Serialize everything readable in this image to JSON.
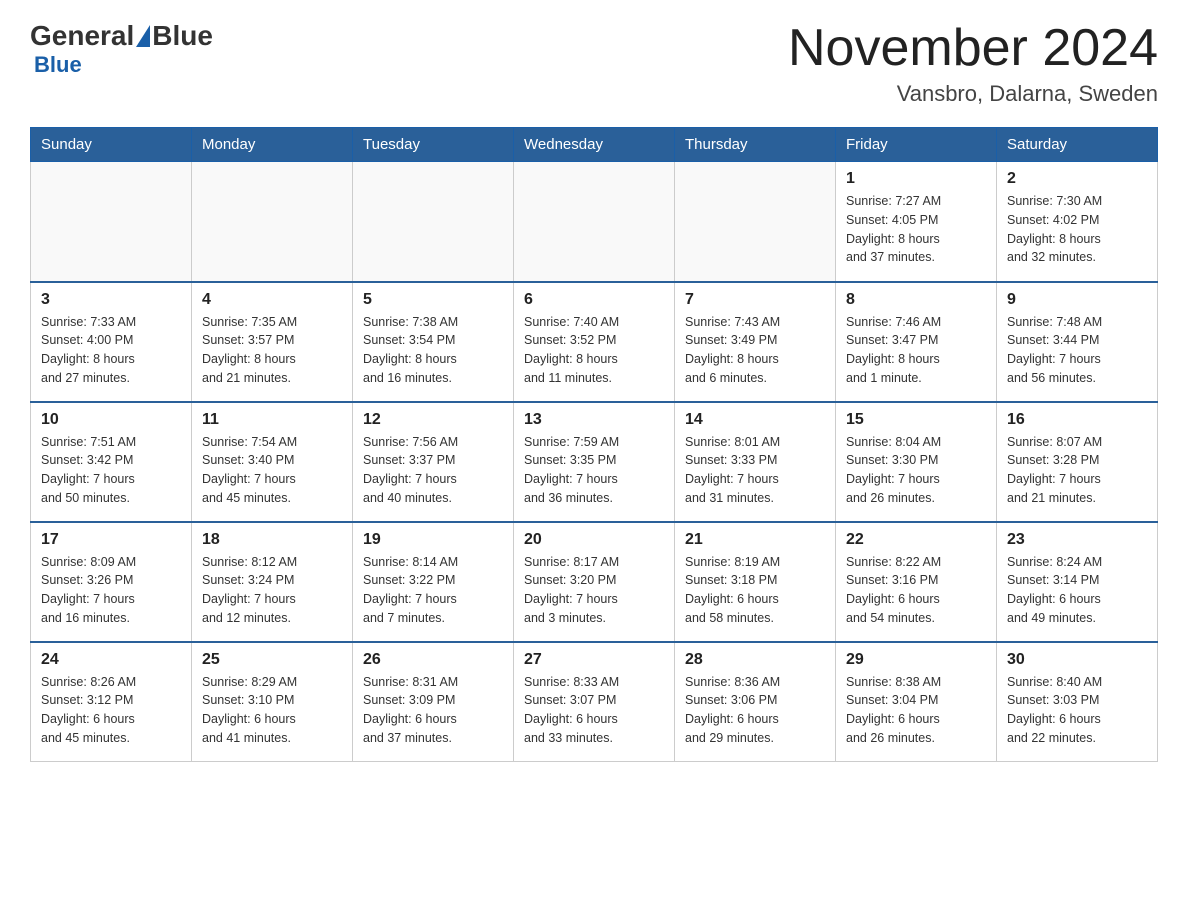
{
  "header": {
    "logo": {
      "part1": "General",
      "part2": "Blue",
      "subtitle": "Blue"
    },
    "title": "November 2024",
    "location": "Vansbro, Dalarna, Sweden"
  },
  "weekdays": [
    "Sunday",
    "Monday",
    "Tuesday",
    "Wednesday",
    "Thursday",
    "Friday",
    "Saturday"
  ],
  "weeks": [
    [
      {
        "day": "",
        "info": ""
      },
      {
        "day": "",
        "info": ""
      },
      {
        "day": "",
        "info": ""
      },
      {
        "day": "",
        "info": ""
      },
      {
        "day": "",
        "info": ""
      },
      {
        "day": "1",
        "info": "Sunrise: 7:27 AM\nSunset: 4:05 PM\nDaylight: 8 hours\nand 37 minutes."
      },
      {
        "day": "2",
        "info": "Sunrise: 7:30 AM\nSunset: 4:02 PM\nDaylight: 8 hours\nand 32 minutes."
      }
    ],
    [
      {
        "day": "3",
        "info": "Sunrise: 7:33 AM\nSunset: 4:00 PM\nDaylight: 8 hours\nand 27 minutes."
      },
      {
        "day": "4",
        "info": "Sunrise: 7:35 AM\nSunset: 3:57 PM\nDaylight: 8 hours\nand 21 minutes."
      },
      {
        "day": "5",
        "info": "Sunrise: 7:38 AM\nSunset: 3:54 PM\nDaylight: 8 hours\nand 16 minutes."
      },
      {
        "day": "6",
        "info": "Sunrise: 7:40 AM\nSunset: 3:52 PM\nDaylight: 8 hours\nand 11 minutes."
      },
      {
        "day": "7",
        "info": "Sunrise: 7:43 AM\nSunset: 3:49 PM\nDaylight: 8 hours\nand 6 minutes."
      },
      {
        "day": "8",
        "info": "Sunrise: 7:46 AM\nSunset: 3:47 PM\nDaylight: 8 hours\nand 1 minute."
      },
      {
        "day": "9",
        "info": "Sunrise: 7:48 AM\nSunset: 3:44 PM\nDaylight: 7 hours\nand 56 minutes."
      }
    ],
    [
      {
        "day": "10",
        "info": "Sunrise: 7:51 AM\nSunset: 3:42 PM\nDaylight: 7 hours\nand 50 minutes."
      },
      {
        "day": "11",
        "info": "Sunrise: 7:54 AM\nSunset: 3:40 PM\nDaylight: 7 hours\nand 45 minutes."
      },
      {
        "day": "12",
        "info": "Sunrise: 7:56 AM\nSunset: 3:37 PM\nDaylight: 7 hours\nand 40 minutes."
      },
      {
        "day": "13",
        "info": "Sunrise: 7:59 AM\nSunset: 3:35 PM\nDaylight: 7 hours\nand 36 minutes."
      },
      {
        "day": "14",
        "info": "Sunrise: 8:01 AM\nSunset: 3:33 PM\nDaylight: 7 hours\nand 31 minutes."
      },
      {
        "day": "15",
        "info": "Sunrise: 8:04 AM\nSunset: 3:30 PM\nDaylight: 7 hours\nand 26 minutes."
      },
      {
        "day": "16",
        "info": "Sunrise: 8:07 AM\nSunset: 3:28 PM\nDaylight: 7 hours\nand 21 minutes."
      }
    ],
    [
      {
        "day": "17",
        "info": "Sunrise: 8:09 AM\nSunset: 3:26 PM\nDaylight: 7 hours\nand 16 minutes."
      },
      {
        "day": "18",
        "info": "Sunrise: 8:12 AM\nSunset: 3:24 PM\nDaylight: 7 hours\nand 12 minutes."
      },
      {
        "day": "19",
        "info": "Sunrise: 8:14 AM\nSunset: 3:22 PM\nDaylight: 7 hours\nand 7 minutes."
      },
      {
        "day": "20",
        "info": "Sunrise: 8:17 AM\nSunset: 3:20 PM\nDaylight: 7 hours\nand 3 minutes."
      },
      {
        "day": "21",
        "info": "Sunrise: 8:19 AM\nSunset: 3:18 PM\nDaylight: 6 hours\nand 58 minutes."
      },
      {
        "day": "22",
        "info": "Sunrise: 8:22 AM\nSunset: 3:16 PM\nDaylight: 6 hours\nand 54 minutes."
      },
      {
        "day": "23",
        "info": "Sunrise: 8:24 AM\nSunset: 3:14 PM\nDaylight: 6 hours\nand 49 minutes."
      }
    ],
    [
      {
        "day": "24",
        "info": "Sunrise: 8:26 AM\nSunset: 3:12 PM\nDaylight: 6 hours\nand 45 minutes."
      },
      {
        "day": "25",
        "info": "Sunrise: 8:29 AM\nSunset: 3:10 PM\nDaylight: 6 hours\nand 41 minutes."
      },
      {
        "day": "26",
        "info": "Sunrise: 8:31 AM\nSunset: 3:09 PM\nDaylight: 6 hours\nand 37 minutes."
      },
      {
        "day": "27",
        "info": "Sunrise: 8:33 AM\nSunset: 3:07 PM\nDaylight: 6 hours\nand 33 minutes."
      },
      {
        "day": "28",
        "info": "Sunrise: 8:36 AM\nSunset: 3:06 PM\nDaylight: 6 hours\nand 29 minutes."
      },
      {
        "day": "29",
        "info": "Sunrise: 8:38 AM\nSunset: 3:04 PM\nDaylight: 6 hours\nand 26 minutes."
      },
      {
        "day": "30",
        "info": "Sunrise: 8:40 AM\nSunset: 3:03 PM\nDaylight: 6 hours\nand 22 minutes."
      }
    ]
  ]
}
